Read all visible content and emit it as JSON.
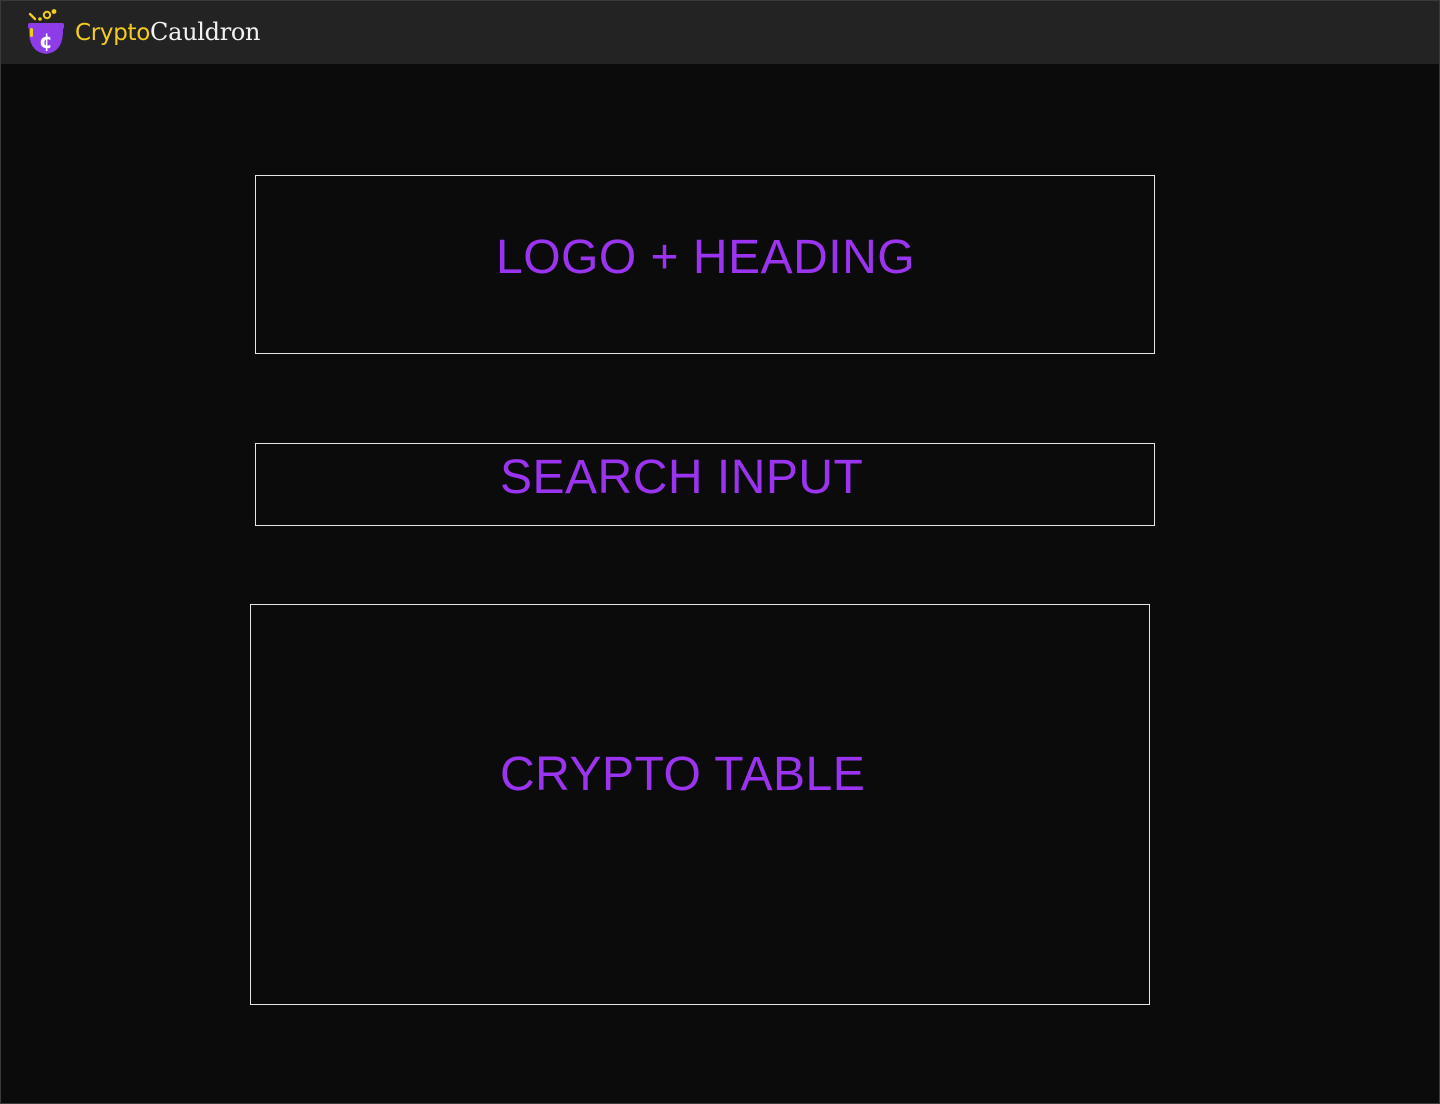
{
  "navbar": {
    "brand_part_1": "Crypto",
    "brand_part_2": "Cauldron",
    "logo_icon": "cauldron-coin-icon",
    "colors": {
      "background": "#232323",
      "brand_yellow": "#f3cc1f",
      "brand_purple": "#8e3ce8",
      "brand_text": "#f2f2f2"
    }
  },
  "wireframe": {
    "heading_section": {
      "label": "LOGO + HEADING"
    },
    "search_section": {
      "label": "SEARCH INPUT"
    },
    "table_section": {
      "label": "CRYPTO TABLE"
    },
    "colors": {
      "page_background": "#0b0b0b",
      "box_border": "#e6e6e6",
      "label_color": "#9b34f0"
    }
  }
}
